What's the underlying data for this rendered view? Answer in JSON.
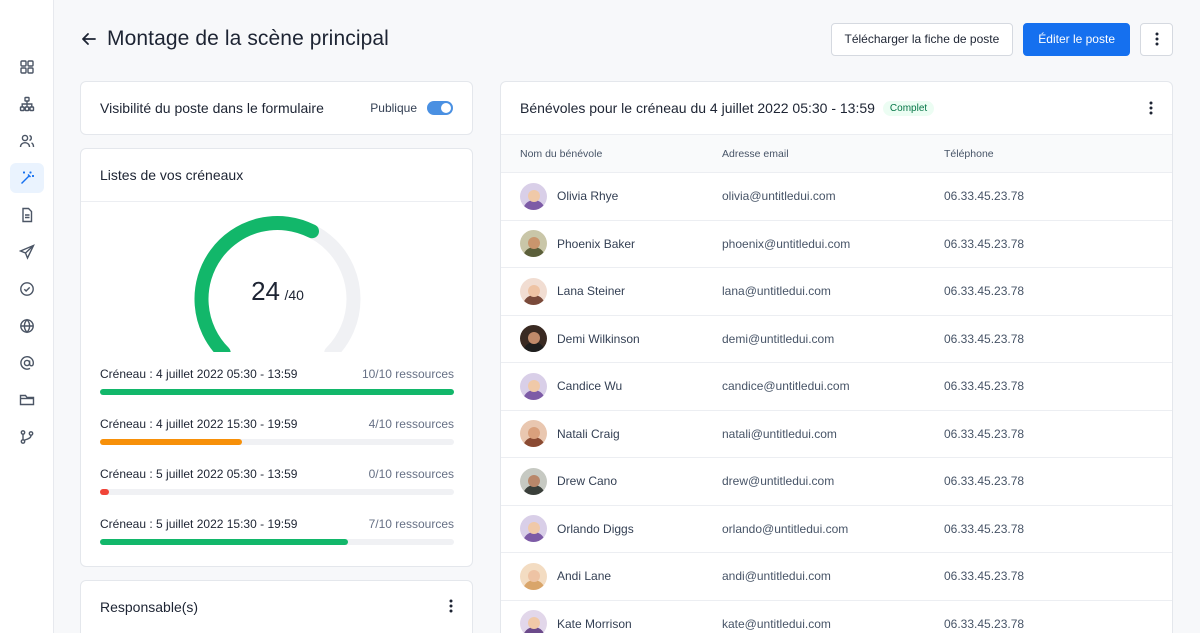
{
  "sidebar": {
    "items": [
      {
        "name": "dashboard-icon",
        "active": false
      },
      {
        "name": "sitemap-icon",
        "active": false
      },
      {
        "name": "users-icon",
        "active": false
      },
      {
        "name": "magic-wand-icon",
        "active": true
      },
      {
        "name": "document-icon",
        "active": false
      },
      {
        "name": "send-icon",
        "active": false
      },
      {
        "name": "check-circle-icon",
        "active": false
      },
      {
        "name": "globe-icon",
        "active": false
      },
      {
        "name": "at-sign-icon",
        "active": false
      },
      {
        "name": "folder-icon",
        "active": false
      },
      {
        "name": "git-branch-icon",
        "active": false
      }
    ]
  },
  "header": {
    "title": "Montage de la scène principal",
    "download_label": "Télécharger la fiche de poste",
    "edit_label": "Éditer le poste"
  },
  "visibility": {
    "title": "Visibilité du poste dans le formulaire",
    "toggle_label": "Publique",
    "toggle_on": true
  },
  "slots": {
    "title": "Listes de vos créneaux",
    "gauge": {
      "value": 24,
      "total": 40,
      "value_text": "24",
      "total_text": "/40"
    },
    "items": [
      {
        "label": "Créneau : 4 juillet 2022 05:30 - 13:59",
        "count": "10/10 ressources",
        "fraction": 1.0,
        "color": "#12b76a"
      },
      {
        "label": "Créneau : 4 juillet 2022 15:30 - 19:59",
        "count": "4/10 ressources",
        "fraction": 0.4,
        "color": "#f79009"
      },
      {
        "label": "Créneau : 5 juillet 2022 05:30 - 13:59",
        "count": "0/10 ressources",
        "fraction": 0.025,
        "color": "#f04438"
      },
      {
        "label": "Créneau : 5 juillet 2022 15:30 - 19:59",
        "count": "7/10 ressources",
        "fraction": 0.7,
        "color": "#12b76a"
      }
    ]
  },
  "responsable": {
    "title": "Responsable(s)"
  },
  "volunteers": {
    "title": "Bénévoles pour le créneau du 4 juillet 2022 05:30 - 13:59",
    "badge": "Complet",
    "columns": {
      "name": "Nom du bénévole",
      "email": "Adresse email",
      "phone": "Téléphone"
    },
    "rows": [
      {
        "name": "Olivia Rhye",
        "email": "olivia@untitledui.com",
        "phone": "06.33.45.23.78",
        "bg": "#d9cfe8",
        "skin": "#f0c9a8",
        "shirt": "#7d5ba6"
      },
      {
        "name": "Phoenix Baker",
        "email": "phoenix@untitledui.com",
        "phone": "06.33.45.23.78",
        "bg": "#c9c6a8",
        "skin": "#c9956d",
        "shirt": "#5b5f3a"
      },
      {
        "name": "Lana Steiner",
        "email": "lana@untitledui.com",
        "phone": "06.33.45.23.78",
        "bg": "#f1ddd2",
        "skin": "#eec3a4",
        "shirt": "#7a4a3a"
      },
      {
        "name": "Demi Wilkinson",
        "email": "demi@untitledui.com",
        "phone": "06.33.45.23.78",
        "bg": "#3a2a22",
        "skin": "#c08a6a",
        "shirt": "#1e1e1e"
      },
      {
        "name": "Candice Wu",
        "email": "candice@untitledui.com",
        "phone": "06.33.45.23.78",
        "bg": "#d9cfe8",
        "skin": "#f0c9a8",
        "shirt": "#7d5ba6"
      },
      {
        "name": "Natali Craig",
        "email": "natali@untitledui.com",
        "phone": "06.33.45.23.78",
        "bg": "#e9c7b0",
        "skin": "#d9a07c",
        "shirt": "#8a4a32"
      },
      {
        "name": "Drew Cano",
        "email": "drew@untitledui.com",
        "phone": "06.33.45.23.78",
        "bg": "#c6c9c2",
        "skin": "#b9876a",
        "shirt": "#3a3f3a"
      },
      {
        "name": "Orlando Diggs",
        "email": "orlando@untitledui.com",
        "phone": "06.33.45.23.78",
        "bg": "#d9cfe8",
        "skin": "#f0c9a8",
        "shirt": "#7d5ba6"
      },
      {
        "name": "Andi Lane",
        "email": "andi@untitledui.com",
        "phone": "06.33.45.23.78",
        "bg": "#f3dcc2",
        "skin": "#eec3a4",
        "shirt": "#d9a56a"
      },
      {
        "name": "Kate Morrison",
        "email": "kate@untitledui.com",
        "phone": "06.33.45.23.78",
        "bg": "#e2d7ea",
        "skin": "#f0c9a8",
        "shirt": "#6b4a8a"
      }
    ]
  }
}
